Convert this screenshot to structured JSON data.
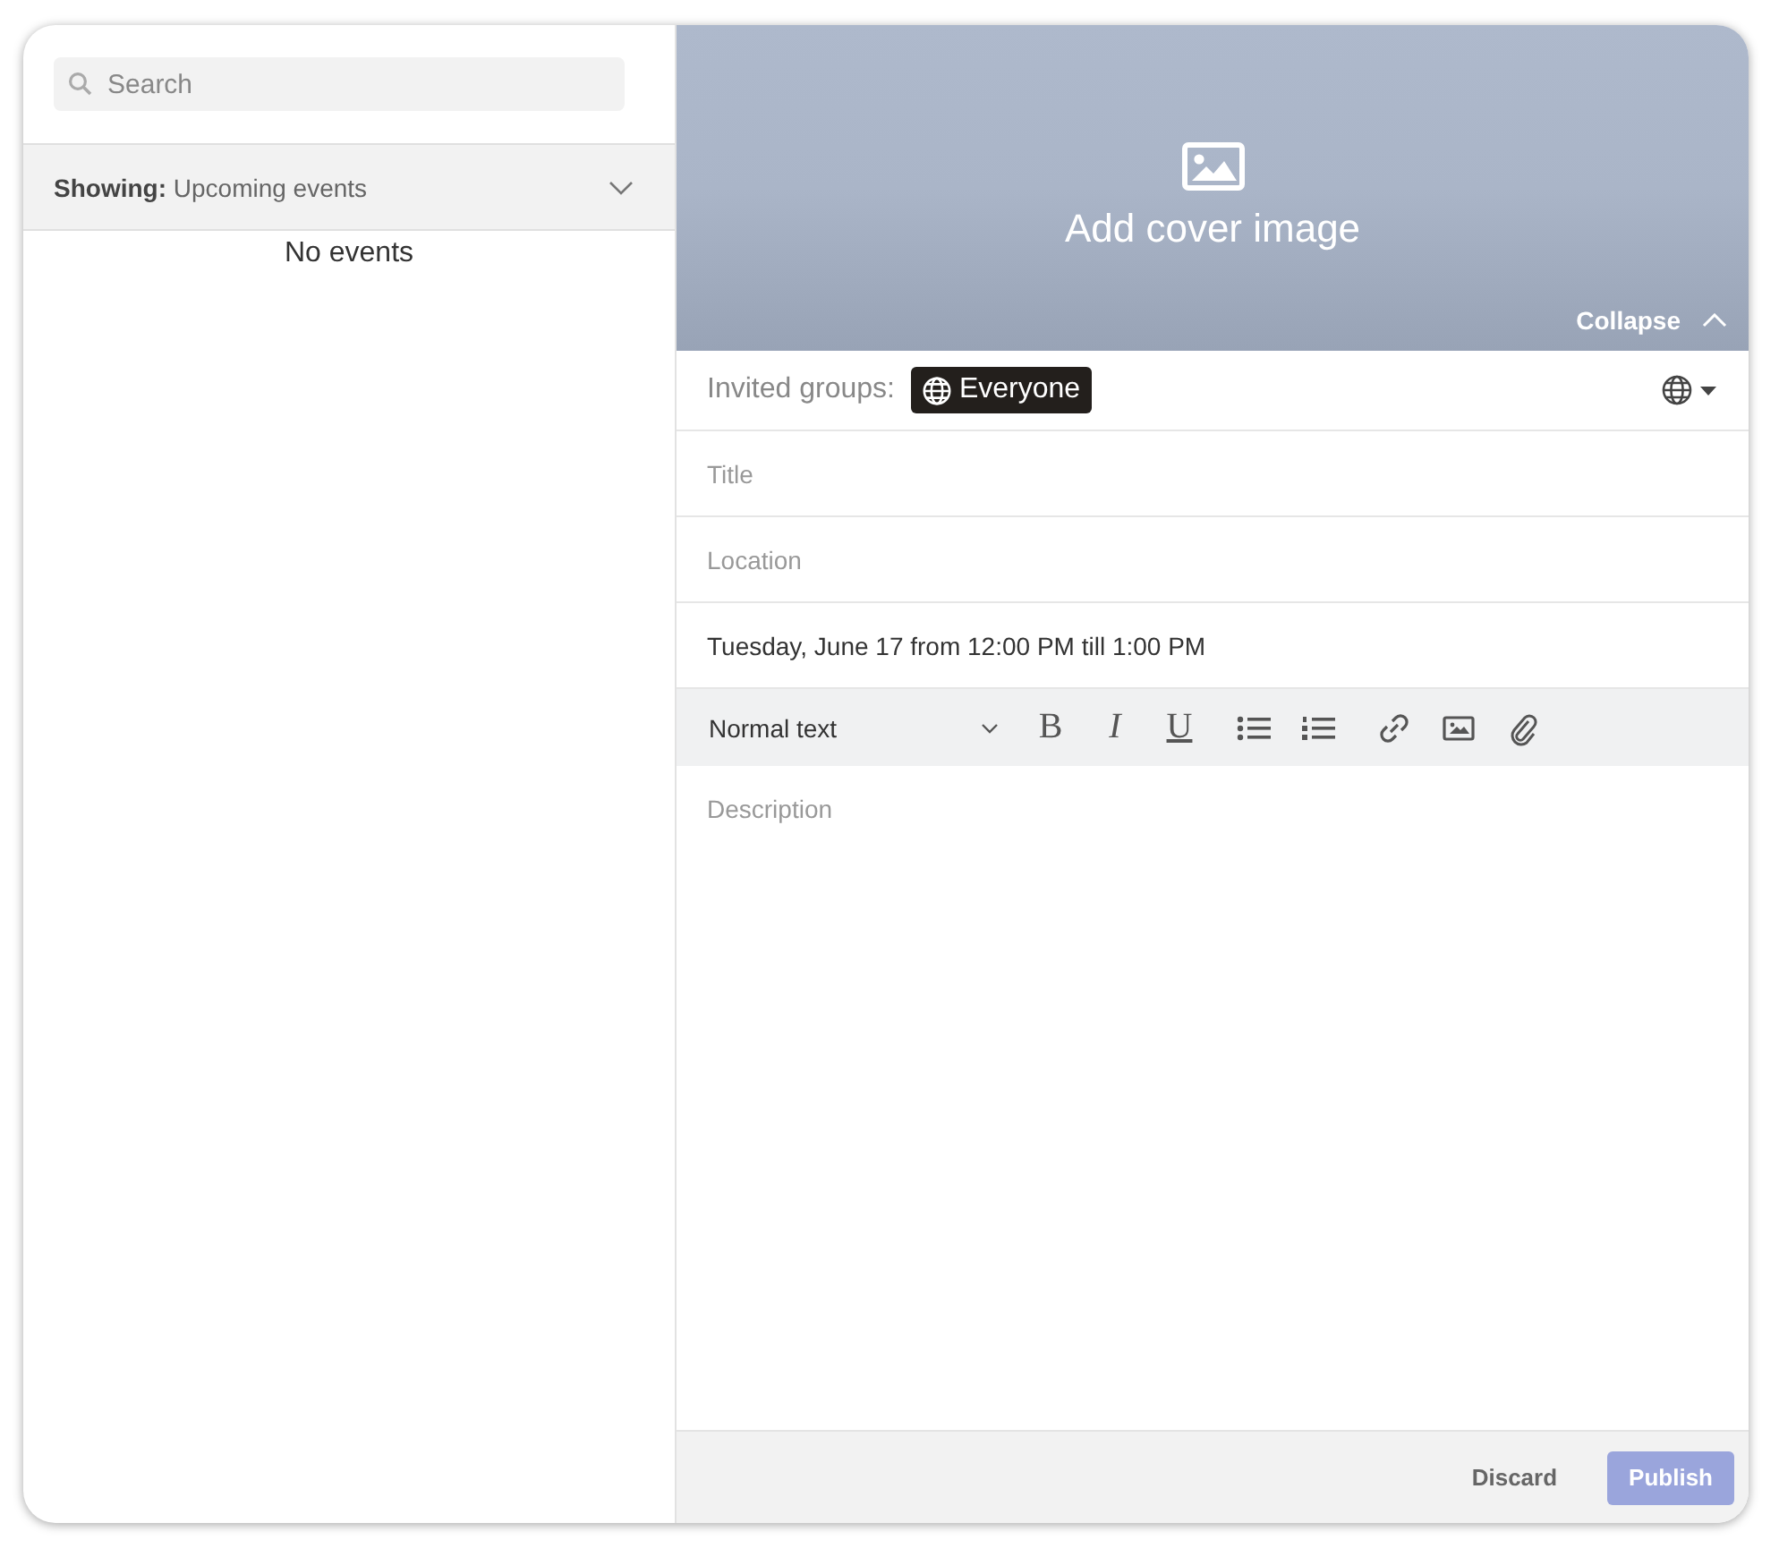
{
  "sidebar": {
    "search": {
      "placeholder": "Search"
    },
    "filter": {
      "label": "Showing:",
      "value": "Upcoming events"
    },
    "empty_message": "No events"
  },
  "cover": {
    "label": "Add cover image",
    "collapse": "Collapse"
  },
  "invited": {
    "label": "Invited groups:",
    "chip": "Everyone"
  },
  "fields": [
    {
      "placeholder": "Title"
    },
    {
      "placeholder": "Location"
    },
    {
      "value": "Tuesday, June 17 from 12:00 PM till 1:00 PM"
    }
  ],
  "toolbar": {
    "format": "Normal text",
    "tools": [
      {
        "kind": "bold",
        "label": "B"
      },
      {
        "kind": "italic",
        "label": "I"
      },
      {
        "kind": "underline",
        "label": "U"
      },
      {
        "kind": "bullets"
      },
      {
        "kind": "numbers"
      },
      {
        "kind": "link"
      },
      {
        "kind": "image"
      },
      {
        "kind": "attach"
      }
    ]
  },
  "description": {
    "placeholder": "Description"
  },
  "footer": {
    "discard": "Discard",
    "publish": {
      "label": "Publish",
      "disabled": true
    }
  }
}
